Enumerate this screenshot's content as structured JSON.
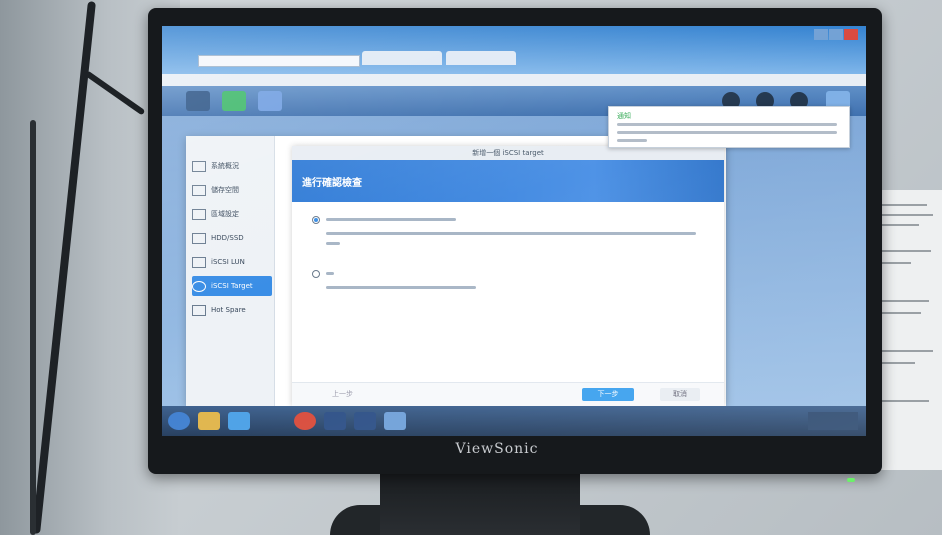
{
  "screen": {
    "dsm": {
      "sidebar": {
        "items": [
          {
            "label": "系統概況",
            "active": false
          },
          {
            "label": "儲存空間",
            "active": false
          },
          {
            "label": "區域設定",
            "active": false
          },
          {
            "label": "HDD/SSD",
            "active": false
          },
          {
            "label": "iSCSI LUN",
            "active": false
          },
          {
            "label": "iSCSI Target",
            "active": true
          },
          {
            "label": "Hot Spare",
            "active": false
          }
        ]
      },
      "wizard": {
        "title": "新增一個 iSCSI target",
        "header": "進行確認檢查",
        "next_button": "下一步",
        "cancel_button": "取消",
        "back_button": "上一步"
      },
      "notification": {
        "title": "通知"
      }
    },
    "monitor_brand": "ViewSonic"
  },
  "colors": {
    "accent": "#3a8ee6",
    "header": "#2e7ad6"
  }
}
